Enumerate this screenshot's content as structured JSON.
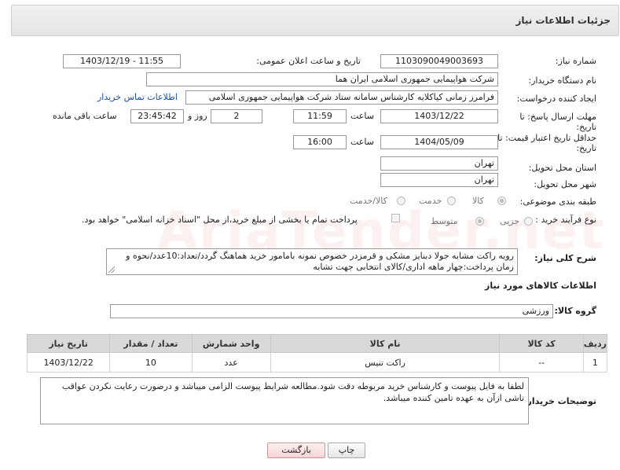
{
  "panel": {
    "title": "جزئیات اطلاعات نیاز"
  },
  "need_number": {
    "label": "شماره نیاز:",
    "value": "1103090049003693"
  },
  "announce_datetime": {
    "label": "تاریخ و ساعت اعلان عمومی:",
    "value": "1403/12/19 - 11:55"
  },
  "buyer_org": {
    "label": "نام دستگاه خریدار:",
    "value": "شرکت هواپیمایی جمهوری اسلامی ایران هما"
  },
  "requester": {
    "label": "ایجاد کننده درخواست:",
    "value": "فرامرز زمانی کیاکلایه کارشناس سامانه ستاد شرکت هواپیمایی جمهوری اسلامی",
    "contact_link": "اطلاعات تماس خریدار"
  },
  "reply_deadline": {
    "label_line1": "مهلت ارسال پاسخ: تا",
    "label_line2": "تاریخ:",
    "date": "1403/12/22",
    "time_label": "ساعت",
    "time": "11:59",
    "days": "2",
    "days_label": "روز و",
    "remaining": "23:45:42",
    "remaining_label": "ساعت باقی مانده"
  },
  "price_validity": {
    "label_line1": "حداقل تاریخ اعتبار قیمت: تا",
    "label_line2": "تاریخ:",
    "date": "1404/05/09",
    "time_label": "ساعت",
    "time": "16:00"
  },
  "delivery_province": {
    "label": "استان محل تحویل:",
    "value": "تهران"
  },
  "delivery_city": {
    "label": "شهر محل تحویل:",
    "value": "تهران"
  },
  "category": {
    "label": "طبقه بندی موضوعی:",
    "options": [
      "کالا",
      "خدمت",
      "کالا/خدمت"
    ],
    "selected": "کالا"
  },
  "purchase_process": {
    "label": "نوع فرآیند خرید :",
    "options": [
      "جزیی",
      "متوسط"
    ],
    "selected": "متوسط",
    "payment_note": "پرداخت تمام یا بخشی از مبلغ خرید،از محل \"اسناد خزانه اسلامی\" خواهد بود."
  },
  "general_description": {
    "label": "شرح کلی نیاز:",
    "value": "رویه راکت مشابه جولا دبنایز مشکی و قرمزدر خصوص نمونه بامامور خرید هماهنگ گردد/تعداد:10عدد/نحوه و زمان پرداخت:چهار ماهه اداری/کالای انتخابی جهت تشابه"
  },
  "goods_info": {
    "title": "اطلاعات کالاهای مورد نیاز"
  },
  "goods_group": {
    "label": "گروه کالا:",
    "value": "ورزشی"
  },
  "items_table": {
    "headers": [
      "ردیف",
      "کد کالا",
      "نام کالا",
      "واحد شمارش",
      "تعداد / مقدار",
      "تاریخ نیاز"
    ],
    "rows": [
      [
        "1",
        "--",
        "راکت تنیس",
        "عدد",
        "10",
        "1403/12/22"
      ]
    ]
  },
  "buyer_notes": {
    "label": "توضیحات خریدار:",
    "value": "لطفا به فایل پیوست و کارشناس خرید مربوطه دقت شود.مطالعه شرایط پیوست الزامی میباشد و درصورت رعایت نکردن عواقب ناشی ازآن به عهده تامین کننده میباشد."
  },
  "buttons": {
    "print": "چاپ",
    "back": "بازگشت"
  },
  "colors": {
    "link": "#1a4fa0",
    "back_button_bg": "#fde4e4",
    "table_header": "#d9d9d9"
  }
}
